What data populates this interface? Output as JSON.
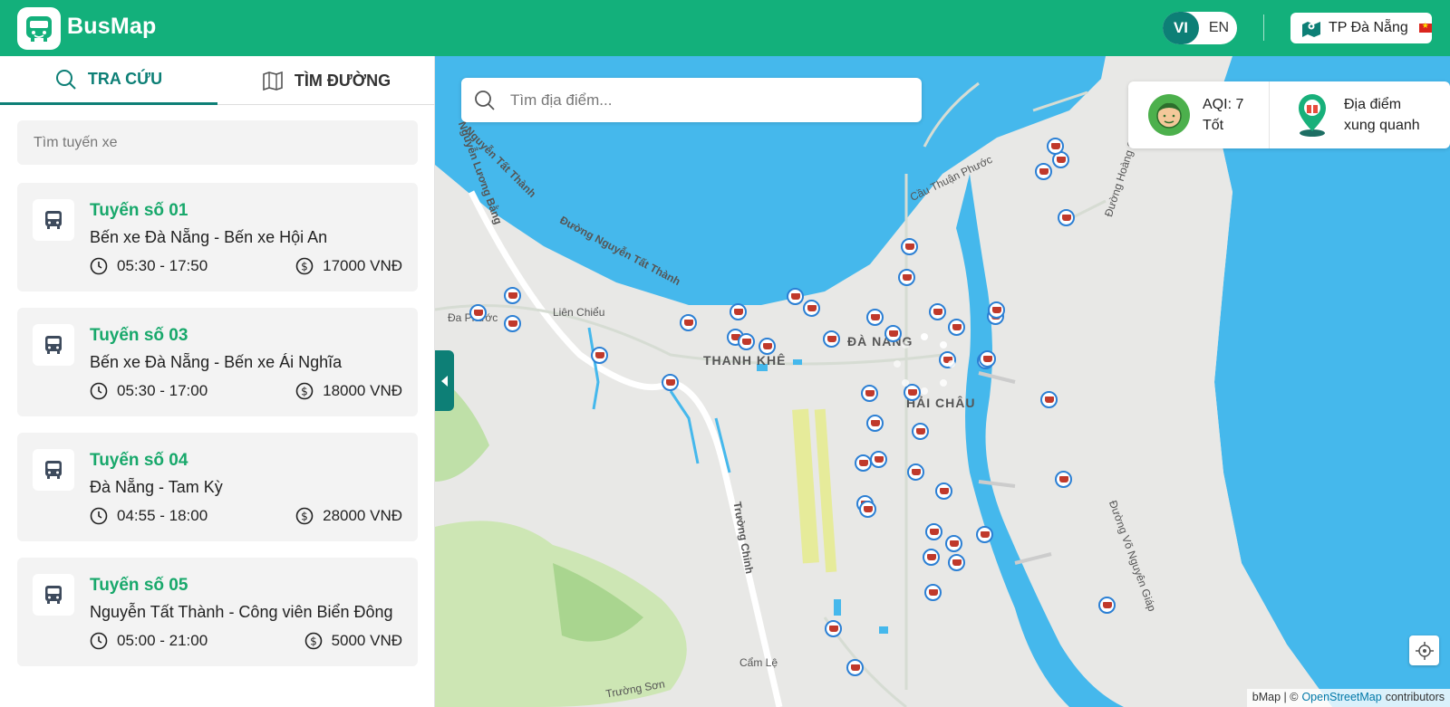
{
  "header": {
    "brand": "BusMap",
    "lang_vi": "VI",
    "lang_en": "EN",
    "city": "TP Đà Nẵng"
  },
  "sidebar": {
    "tabs": [
      {
        "label": "TRA CỨU",
        "active": true
      },
      {
        "label": "TÌM ĐƯỜNG",
        "active": false
      }
    ],
    "search_placeholder": "Tìm tuyến xe",
    "routes": [
      {
        "title": "Tuyến số 01",
        "name": "Bến xe Đà Nẵng - Bến xe Hội An",
        "time": "05:30 - 17:50",
        "price": "17000 VNĐ"
      },
      {
        "title": "Tuyến số 03",
        "name": "Bến xe Đà Nẵng - Bến xe Ái Nghĩa",
        "time": "05:30 - 17:00",
        "price": "18000 VNĐ"
      },
      {
        "title": "Tuyến số 04",
        "name": "Đà Nẵng - Tam Kỳ",
        "time": "04:55 - 18:00",
        "price": "28000 VNĐ"
      },
      {
        "title": "Tuyến số 05",
        "name": "Nguyễn Tất Thành - Công viên Biển Đông",
        "time": "05:00 - 21:00",
        "price": "5000 VNĐ"
      }
    ]
  },
  "map": {
    "search_placeholder": "Tìm địa điểm...",
    "aqi_line1": "AQI: 7",
    "aqi_line2": "Tốt",
    "nearby_line1": "Địa điểm",
    "nearby_line2": "xung quanh",
    "labels": {
      "da_nang": "ĐÀ NẴNG",
      "hai_chau": "HẢI CHÂU",
      "thanh_khe": "THANH KHÊ",
      "lien_chieu": "Liên Chiểu",
      "cam_le": "Cẩm Lệ",
      "truong_chinh": "Trường Chinh",
      "nguyen_tat_thanh": "Đường Nguyễn Tất Thành",
      "cau_thuan_phuoc": "Cầu Thuận Phước",
      "duong_hoang_sa": "Đường Hoàng Sa",
      "duong_vo_nguyen_giap": "Đường Võ Nguyên Giáp",
      "truong_son": "Trường Sơn",
      "nguyen_luong_bang": "Nguyễn Lương Bằng",
      "nguyen_tat_thanh_2": "Nguyễn Tất Thành",
      "da_phuoc": "Đa Phước"
    },
    "attribution_prefix": "bMap | ©",
    "attribution_link": "OpenStreetMap",
    "attribution_suffix": "contributors"
  },
  "colors": {
    "brand": "#13b07b",
    "accent_dark": "#0d7f76",
    "route_title": "#18a86b",
    "water": "#45b8ec",
    "land": "#e8e8e6"
  }
}
